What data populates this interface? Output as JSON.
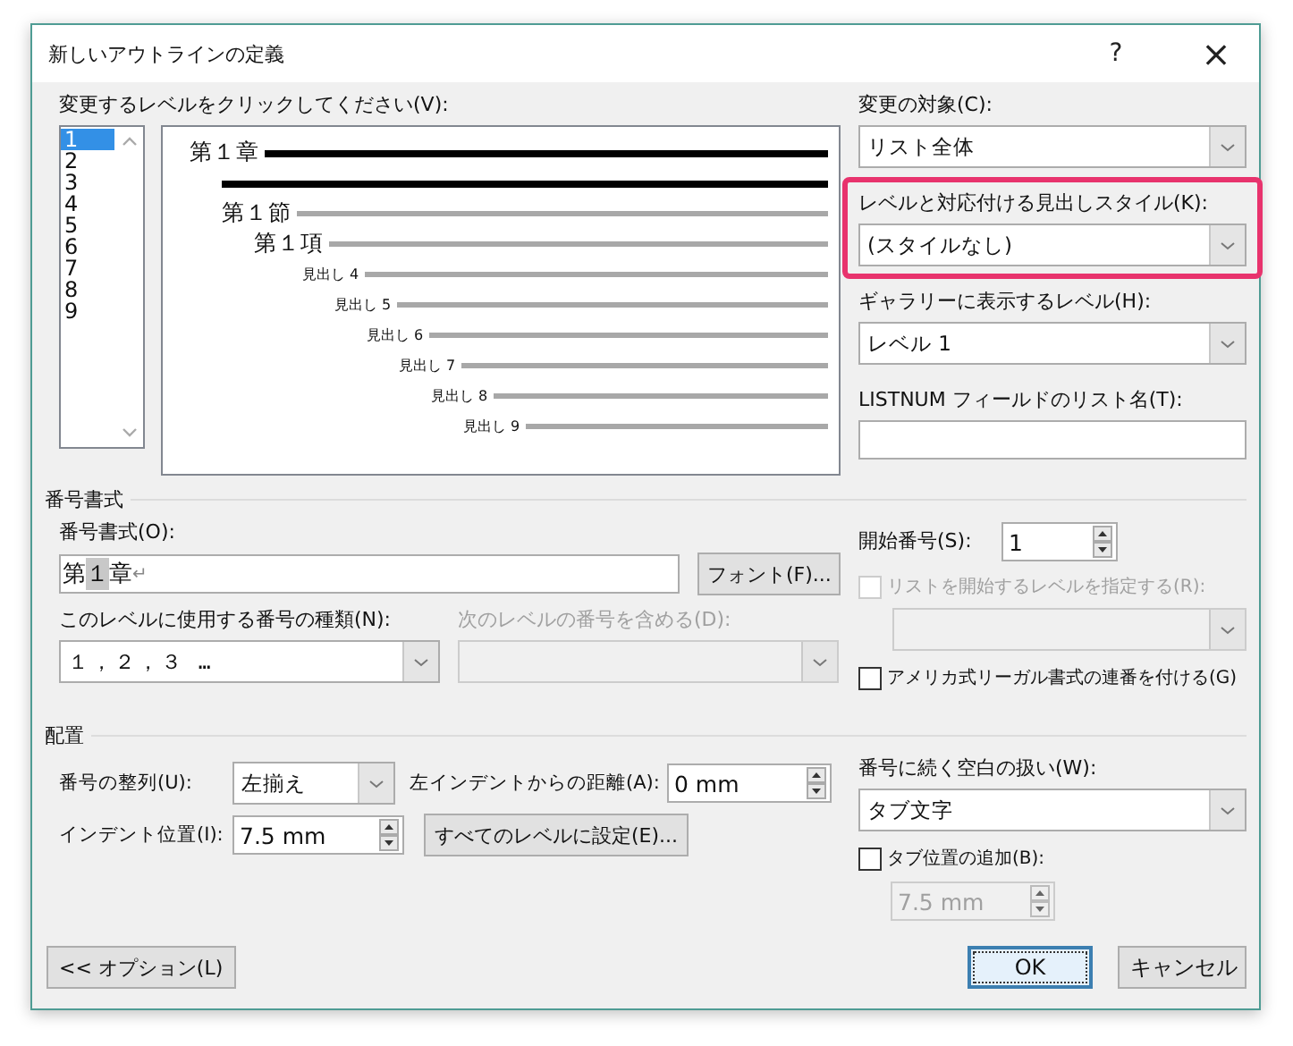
{
  "window": {
    "title": "新しいアウトラインの定義",
    "help_button": "?",
    "close_button": "×"
  },
  "level_list": {
    "label": "変更するレベルをクリックしてください(V):",
    "items": [
      {
        "label": "1",
        "selected": true
      },
      {
        "label": "2",
        "selected": false
      },
      {
        "label": "3",
        "selected": false
      },
      {
        "label": "4",
        "selected": false
      },
      {
        "label": "5",
        "selected": false
      },
      {
        "label": "6",
        "selected": false
      },
      {
        "label": "7",
        "selected": false
      },
      {
        "label": "8",
        "selected": false
      },
      {
        "label": "9",
        "selected": false
      }
    ]
  },
  "preview": {
    "rows": [
      {
        "text": "第１章",
        "kind": "current"
      },
      {
        "kind": "current"
      },
      {
        "text": "第１節",
        "kind": "other"
      },
      {
        "text": "第１項",
        "kind": "other"
      },
      {
        "text": "見出し 4",
        "kind": "other"
      },
      {
        "text": "見出し 5",
        "kind": "other"
      },
      {
        "text": "見出し 6",
        "kind": "other"
      },
      {
        "text": "見出し 7",
        "kind": "other"
      },
      {
        "text": "見出し 8",
        "kind": "other"
      },
      {
        "text": "見出し 9",
        "kind": "other"
      }
    ]
  },
  "apply_to": {
    "label": "変更の対象(C):",
    "value": "リスト全体"
  },
  "heading_style": {
    "label": "レベルと対応付ける見出しスタイル(K):",
    "value": "(スタイルなし)",
    "highlighted": true
  },
  "gallery_level": {
    "label": "ギャラリーに表示するレベル(H):",
    "value": "レベル 1"
  },
  "listnum_name": {
    "label": "LISTNUM フィールドのリスト名(T):"
  },
  "number_format": {
    "heading": "番号書式",
    "label": "番号書式(O):",
    "parts": [
      {
        "text": "第",
        "field": false
      },
      {
        "text": "１",
        "field": true
      },
      {
        "text": "章",
        "field": false
      }
    ],
    "paragraph_mark": "↵",
    "font_button": "フォント(F)...",
    "number_style": {
      "label": "このレベルに使用する番号の種類(N):",
      "value": "１，２，３ …"
    },
    "include_level": {
      "label": "次のレベルの番号を含める(D):",
      "disabled": true
    },
    "start_at": {
      "label": "開始番号(S):",
      "value": "1"
    },
    "restart": {
      "label": "リストを開始するレベルを指定する(R):",
      "checked": false,
      "disabled": true
    },
    "legal": {
      "label": "アメリカ式リーガル書式の連番を付ける(G)",
      "checked": false
    }
  },
  "position": {
    "heading": "配置",
    "alignment": {
      "label": "番号の整列(U):",
      "value": "左揃え"
    },
    "aligned_at": {
      "label": "左インデントからの距離(A):",
      "value": "0 mm"
    },
    "indent_at": {
      "label": "インデント位置(I):",
      "value": "7.5 mm"
    },
    "set_all_button": "すべてのレベルに設定(E)...",
    "follow_with": {
      "label": "番号に続く空白の扱い(W):",
      "value": "タブ文字"
    },
    "tab_stop": {
      "label": "タブ位置の追加(B):",
      "checked": false
    },
    "tab_position": {
      "value": "7.5 mm",
      "disabled": true
    }
  },
  "buttons": [
    {
      "label": "<< オプション(L)",
      "kind": "options"
    },
    {
      "label": "OK",
      "kind": "default"
    },
    {
      "label": "キャンセル",
      "kind": "cancel"
    }
  ]
}
